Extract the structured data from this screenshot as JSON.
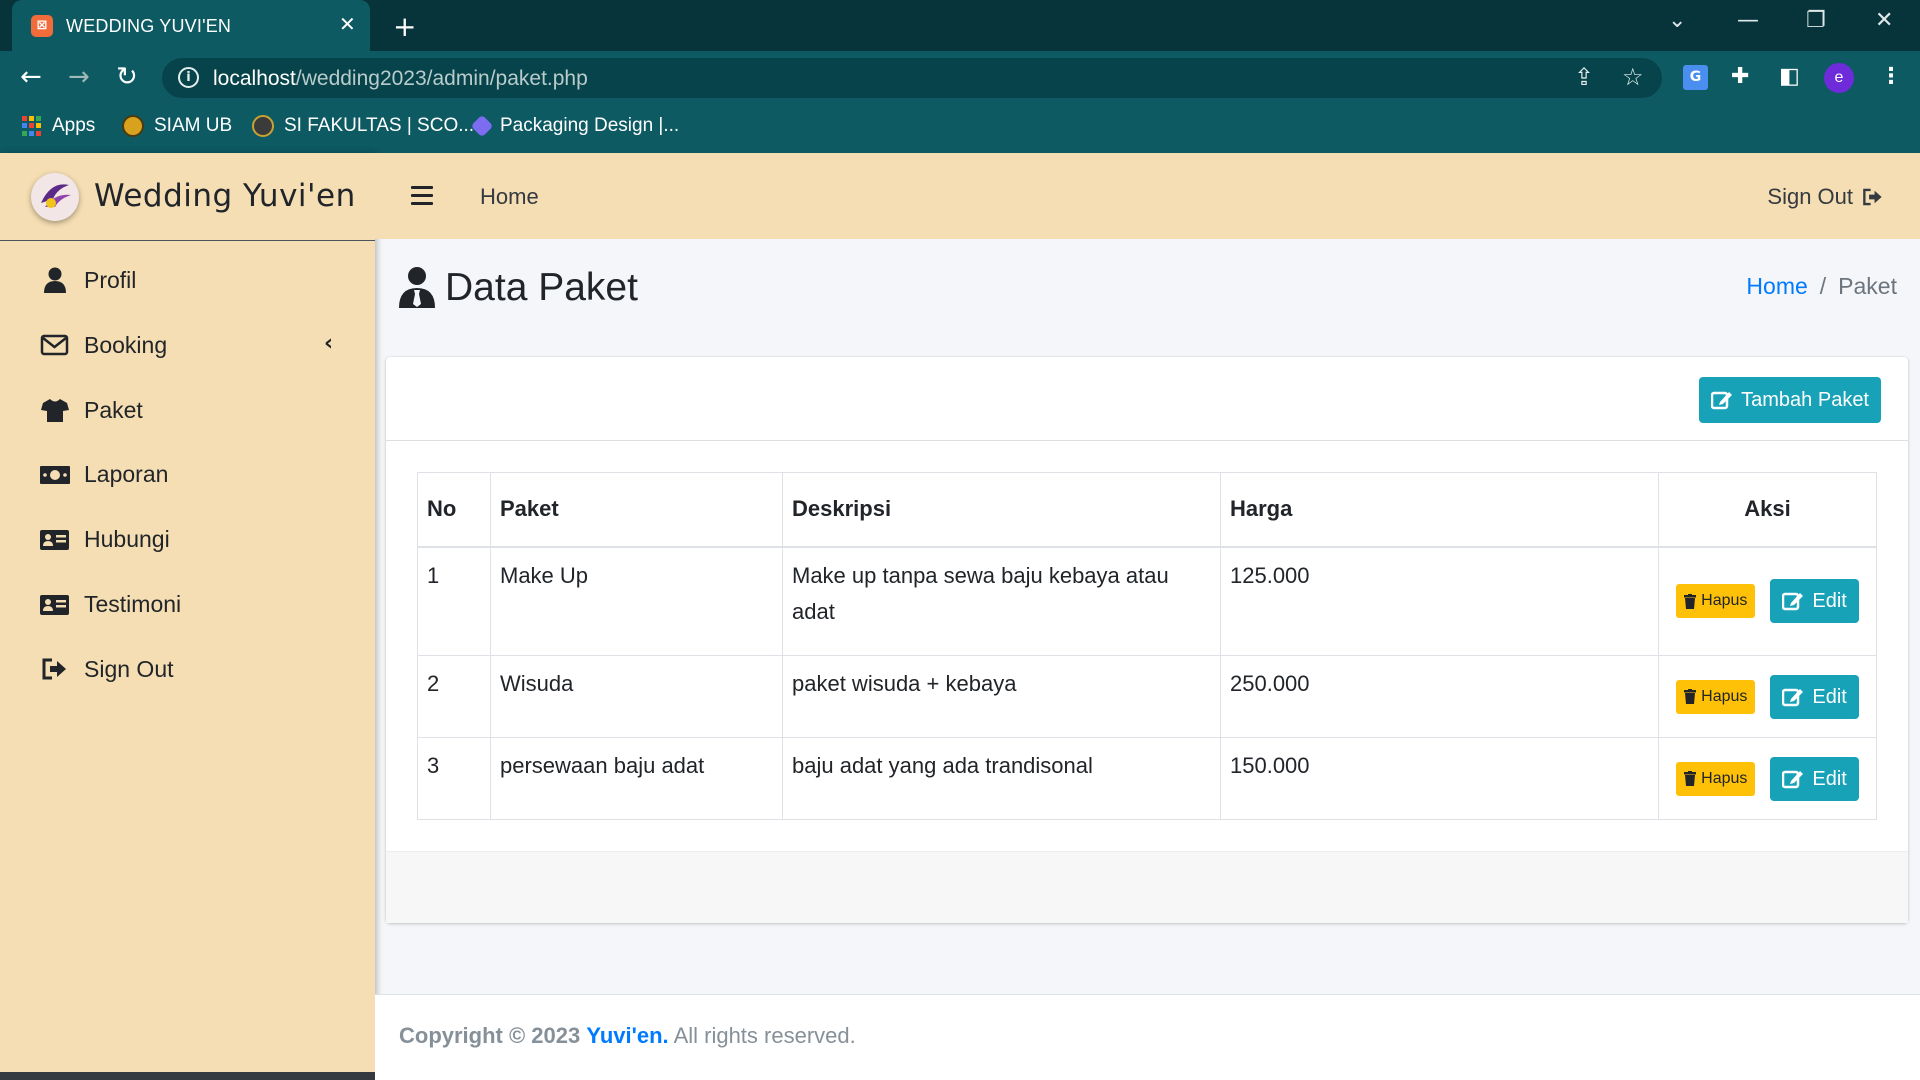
{
  "browser": {
    "tab_title": "WEDDING YUVI'EN",
    "url_host": "localhost",
    "url_path": "/wedding2023/admin/paket.php",
    "bookmarks": [
      "Apps",
      "SIAM UB",
      "SI FAKULTAS | SCO...",
      "Packaging Design |..."
    ],
    "profile_initial": "e"
  },
  "sidebar": {
    "brand": "Wedding Yuvi'en",
    "items": [
      {
        "label": "Profil",
        "icon": "user-icon"
      },
      {
        "label": "Booking",
        "icon": "envelope-icon"
      },
      {
        "label": "Paket",
        "icon": "tshirt-icon"
      },
      {
        "label": "Laporan",
        "icon": "money-bill-icon"
      },
      {
        "label": "Hubungi",
        "icon": "id-card-icon"
      },
      {
        "label": "Testimoni",
        "icon": "id-card-icon"
      },
      {
        "label": "Sign Out",
        "icon": "sign-out-icon"
      }
    ]
  },
  "navbar": {
    "home": "Home",
    "signout": "Sign Out"
  },
  "header": {
    "title": "Data Paket",
    "breadcrumb_home": "Home",
    "breadcrumb_sep": "/",
    "breadcrumb_current": "Paket"
  },
  "card": {
    "add_button": "Tambah Paket"
  },
  "table": {
    "columns": [
      "No",
      "Paket",
      "Deskripsi",
      "Harga",
      "Aksi"
    ],
    "rows": [
      {
        "no": "1",
        "paket": "Make Up",
        "deskripsi": "Make up tanpa sewa baju kebaya atau adat",
        "harga": "125.000"
      },
      {
        "no": "2",
        "paket": "Wisuda",
        "deskripsi": "paket wisuda + kebaya",
        "harga": "250.000"
      },
      {
        "no": "3",
        "paket": "persewaan baju adat",
        "deskripsi": "baju adat yang ada trandisonal",
        "harga": "150.000"
      }
    ],
    "hapus_label": "Hapus",
    "edit_label": "Edit"
  },
  "footer": {
    "prefix": "Copyright © 2023",
    "brand": "Yuvi'en.",
    "suffix": "All rights reserved."
  },
  "colors": {
    "sidebar_bg": "#f5deb3",
    "chrome_bg": "#0d5a63",
    "accent_info": "#17a2b8",
    "warning": "#ffc107",
    "link": "#007bff"
  }
}
